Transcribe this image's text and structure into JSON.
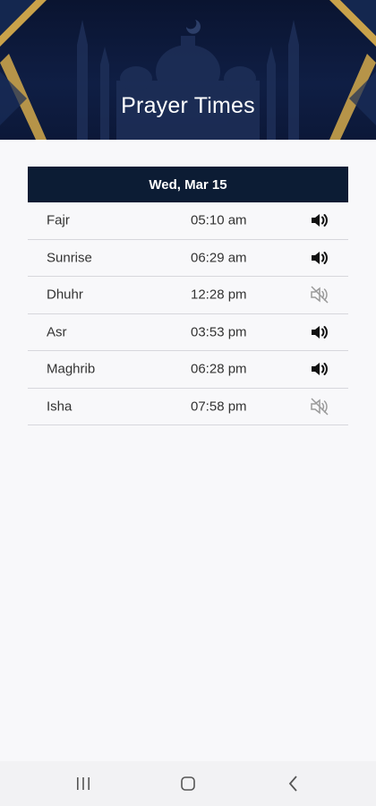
{
  "header": {
    "title": "Prayer Times"
  },
  "schedule": {
    "date": "Wed, Mar 15",
    "prayers": [
      {
        "name": "Fajr",
        "time": "05:10 am",
        "sound": "speaker-on-icon"
      },
      {
        "name": "Sunrise",
        "time": "06:29 am",
        "sound": "speaker-on-icon"
      },
      {
        "name": "Dhuhr",
        "time": "12:28 pm",
        "sound": "speaker-muted-icon"
      },
      {
        "name": "Asr",
        "time": "03:53 pm",
        "sound": "speaker-on-icon"
      },
      {
        "name": "Maghrib",
        "time": "06:28 pm",
        "sound": "speaker-on-icon"
      },
      {
        "name": "Isha",
        "time": "07:58 pm",
        "sound": "speaker-muted-icon"
      }
    ]
  },
  "navbar": {
    "recents": "recents-icon",
    "home": "home-icon",
    "back": "back-icon"
  },
  "colors": {
    "header_bg": "#0f1e44",
    "gold": "#c9a24a",
    "date_bar": "#0c1c34",
    "sound_on": "#111111",
    "sound_off": "#9a9a9a"
  }
}
